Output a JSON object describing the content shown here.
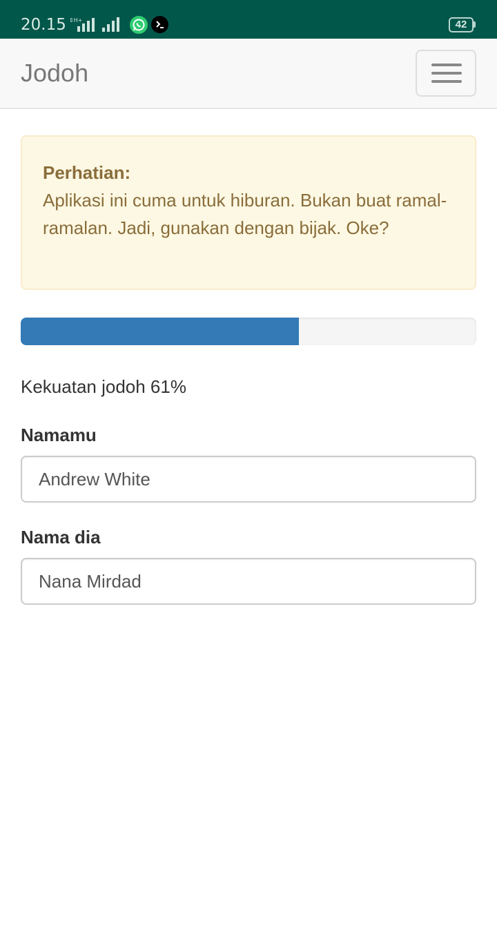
{
  "status_bar": {
    "time": "20.15",
    "network_type": "H+",
    "battery": "42",
    "icons": [
      "signal-icon",
      "whatsapp-icon",
      "terminal-icon",
      "battery-icon"
    ]
  },
  "navbar": {
    "brand": "Jodoh",
    "menu_icon": "hamburger-icon"
  },
  "alert": {
    "title": "Perhatian:",
    "body": "Aplikasi ini cuma untuk hiburan. Bukan buat ramal-ramalan. Jadi, gunakan dengan bijak. Oke?"
  },
  "match": {
    "percent": 61,
    "text": "Kekuatan jodoh 61%"
  },
  "form": {
    "your_name_label": "Namamu",
    "your_name_value": "Andrew White",
    "their_name_label": "Nama dia",
    "their_name_value": "Nana Mirdad"
  },
  "colors": {
    "status_bar": "#02574b",
    "progress": "#337ab7",
    "alert_bg": "#fcf8e3",
    "alert_text": "#8a6d3b"
  }
}
